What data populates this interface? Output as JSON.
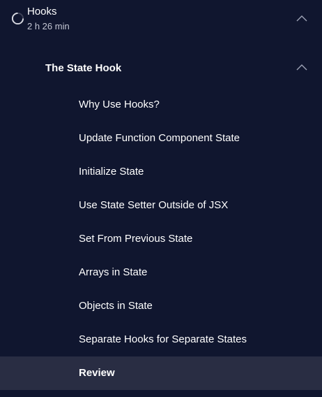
{
  "module": {
    "title": "Hooks",
    "duration": "2 h 26 min"
  },
  "lesson": {
    "title": "The State Hook"
  },
  "items": [
    {
      "label": "Why Use Hooks?"
    },
    {
      "label": "Update Function Component State"
    },
    {
      "label": "Initialize State"
    },
    {
      "label": "Use State Setter Outside of JSX"
    },
    {
      "label": "Set From Previous State"
    },
    {
      "label": "Arrays in State"
    },
    {
      "label": "Objects in State"
    },
    {
      "label": "Separate Hooks for Separate States"
    },
    {
      "label": "Review"
    }
  ],
  "active_item": "Review",
  "colors": {
    "background": "#10162f",
    "active_row": "#292d43",
    "text": "#ffffff",
    "muted_text": "#c3c6d3"
  },
  "icons": {
    "module_status": "progress-ring-icon",
    "collapse": "chevron-up-icon"
  }
}
